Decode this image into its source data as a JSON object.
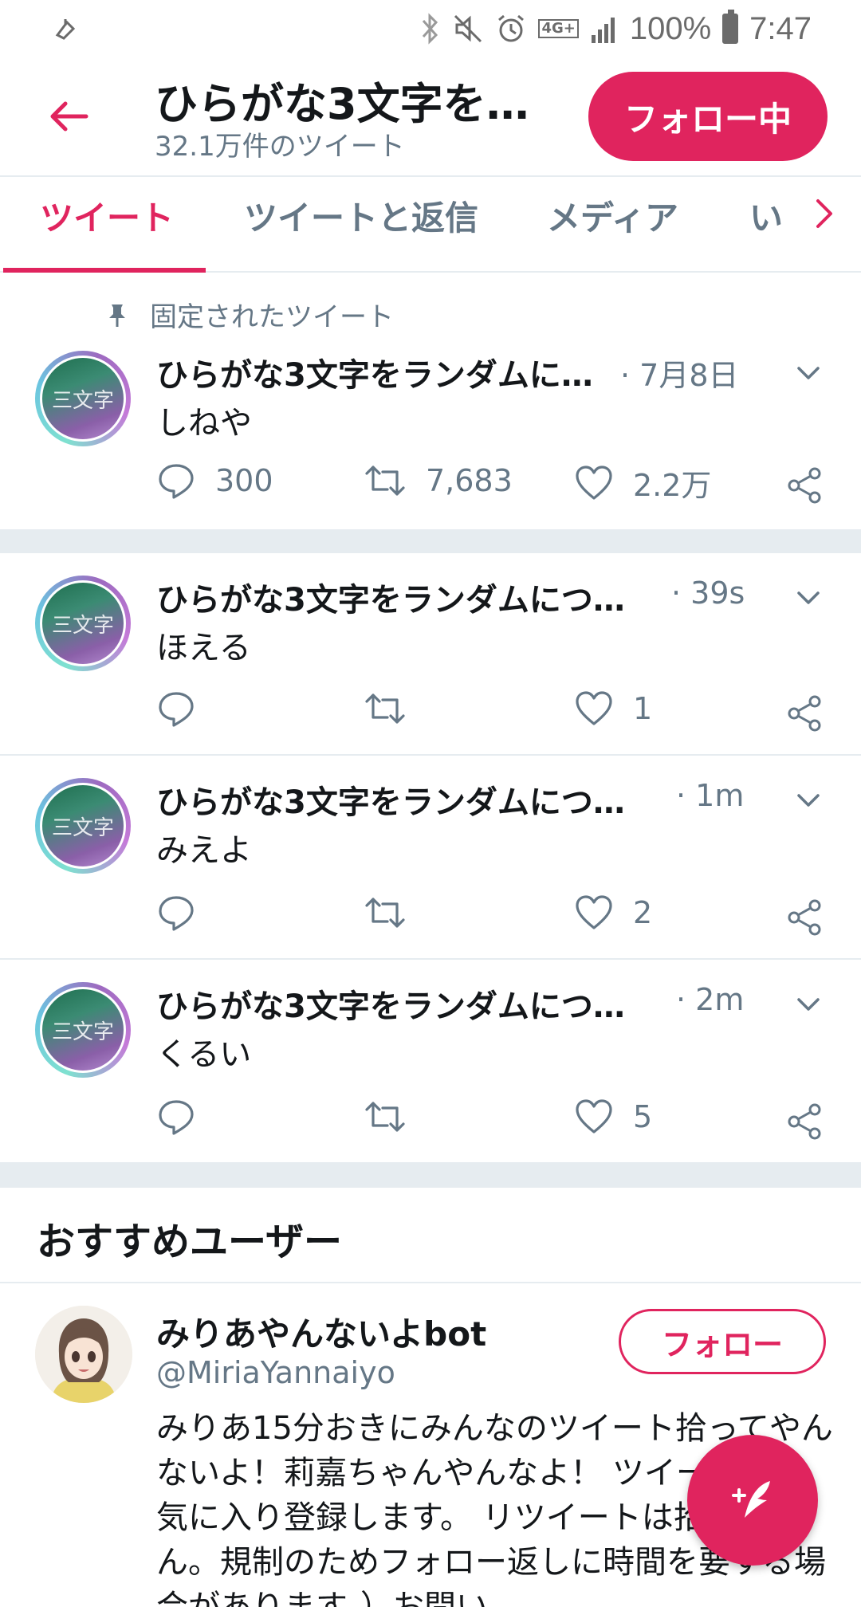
{
  "status_bar": {
    "battery_percent": "100%",
    "time": "7:47",
    "network_label": "4G+"
  },
  "header": {
    "title": "ひらがな3文字を…",
    "subtitle": "32.1万件のツイート",
    "follow_button": "フォロー中"
  },
  "tabs": [
    {
      "label": "ツイート",
      "active": true
    },
    {
      "label": "ツイートと返信",
      "active": false
    },
    {
      "label": "メディア",
      "active": false
    },
    {
      "label": "い",
      "active": false
    }
  ],
  "pinned_label": "固定されたツイート",
  "avatar_label": "三文字",
  "tweets": [
    {
      "name": "ひらがな3文字をランダムに…",
      "time": "· 7月8日",
      "text": "しねや",
      "replies": "300",
      "retweets": "7,683",
      "likes": "2.2万",
      "pinned": true
    },
    {
      "name": "ひらがな3文字をランダムにつ…",
      "time": "· 39s",
      "text": "ほえる",
      "replies": "",
      "retweets": "",
      "likes": "1"
    },
    {
      "name": "ひらがな3文字をランダムにつ…",
      "time": "· 1m",
      "text": "みえよ",
      "replies": "",
      "retweets": "",
      "likes": "2"
    },
    {
      "name": "ひらがな3文字をランダムにつ…",
      "time": "· 2m",
      "text": "くるい",
      "replies": "",
      "retweets": "",
      "likes": "5"
    }
  ],
  "suggested": {
    "title": "おすすめユーザー",
    "user": {
      "name": "みりあやんないよbot",
      "handle": "@MiriaYannaiyo",
      "follow_label": "フォロー",
      "bio": "みりあ15分おきにみんなのツイート拾ってやんないよ！莉嘉ちゃんやんなよ！ ツイートをお気に入り登録します。 リツイートは拾いません。規制のためフォロー返しに時間を要する場合があります。）お問い"
    }
  },
  "colors": {
    "accent": "#e0245e",
    "secondary_text": "#657786",
    "divider": "#e6ecf0"
  },
  "icons": [
    "back-arrow-icon",
    "reply-icon",
    "retweet-icon",
    "like-icon",
    "share-icon",
    "chevron-down-icon",
    "pin-icon",
    "compose-icon"
  ]
}
